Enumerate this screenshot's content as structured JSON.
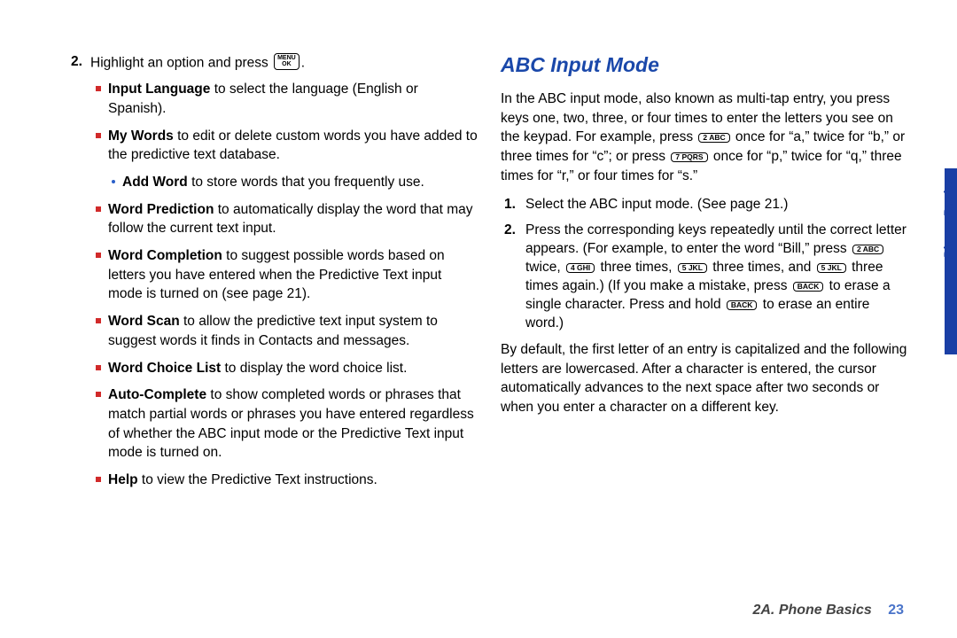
{
  "left": {
    "step2_num": "2.",
    "step2_pre": "Highlight an option and press ",
    "step2_key": "MENU\nOK",
    "step2_post": ".",
    "items": [
      {
        "term": "Input Language",
        "rest": " to select the language (English or Spanish)."
      },
      {
        "term": "My Words",
        "rest": " to edit or delete custom words you have added to the predictive text database."
      },
      {
        "term": "Word Prediction",
        "rest": " to automatically display the word that may follow the current text input."
      },
      {
        "term": "Word Completion",
        "rest": " to suggest possible words based on letters you have entered when the Predictive Text input mode is turned on (see page 21)."
      },
      {
        "term": "Word Scan",
        "rest": " to allow the predictive text input system to suggest words it finds in Contacts and messages."
      },
      {
        "term": "Word Choice List",
        "rest": " to display the word choice list."
      },
      {
        "term": "Auto-Complete",
        "rest": " to show completed words or phrases that match partial words or phrases you have entered regardless of whether the ABC input mode or the Predictive Text input mode is turned on."
      },
      {
        "term": "Help",
        "rest": " to view the Predictive Text instructions."
      }
    ],
    "subitem": {
      "term": "Add Word",
      "rest": " to store words that you frequently use."
    }
  },
  "right": {
    "heading": "ABC Input Mode",
    "p1a": "In the ABC input mode, also known as multi-tap entry, you press keys one, two, three, or four times to enter the letters you see on the keypad. For example, press ",
    "key2": "2 ABC",
    "p1b": " once for “a,” twice for “b,” or three times for “c”; or press ",
    "key7": "7 PQRS",
    "p1c": " once for “p,” twice for “q,” three times for “r,” or four times for “s.”",
    "step1_num": "1.",
    "step1": "Select the ABC input mode. (See page 21.)",
    "step2_num": "2.",
    "s2a": "Press the corresponding keys repeatedly until the correct letter appears. (For example, to enter the word “Bill,” press ",
    "s2b": " twice, ",
    "key4": "4 GHI",
    "s2c": " three times, ",
    "key5": "5 JKL",
    "s2d": " three times, and ",
    "s2e": " three times again.) (If you make a mistake, press ",
    "keyback": "BACK",
    "s2f": " to erase a single character. Press and hold ",
    "s2g": " to erase an entire word.)",
    "p2": "By default, the first letter of an entry is capitalized and the following letters are lowercased. After a character is entered, the cursor automatically advances to the next space after two seconds or when you enter a character on a different key."
  },
  "side": "Phone Basics",
  "footer_section": "2A. Phone Basics",
  "footer_page": "23"
}
